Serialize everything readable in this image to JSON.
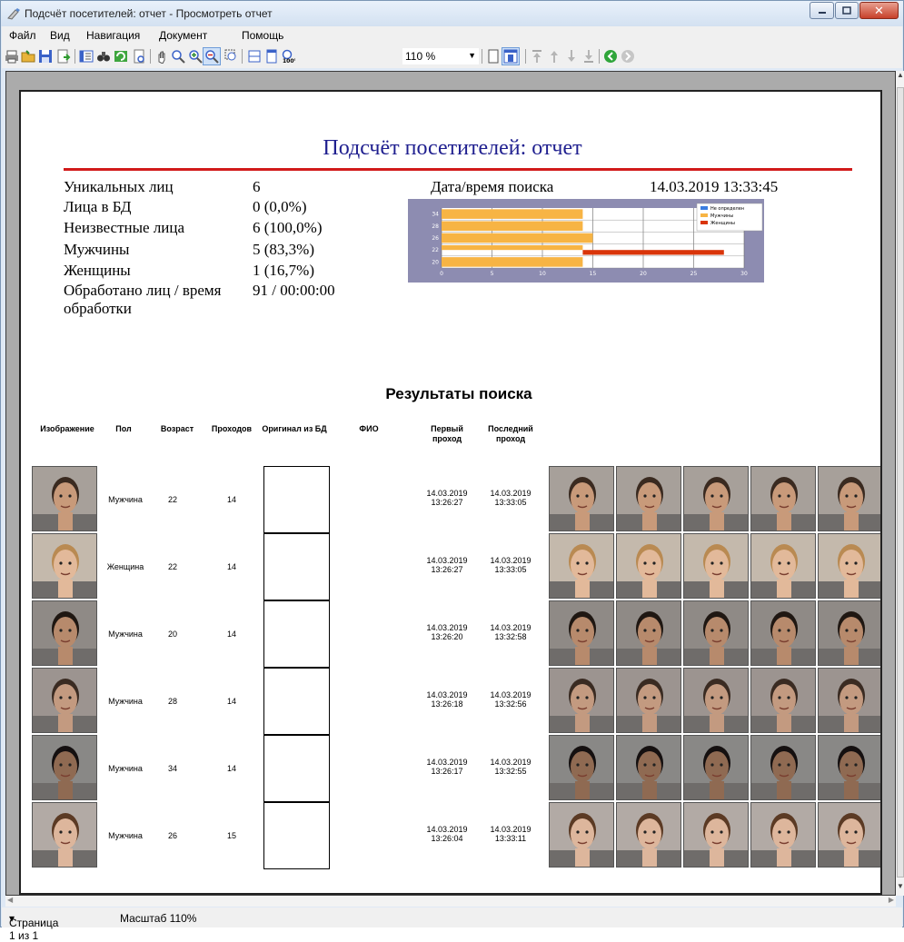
{
  "window": {
    "title": "Подсчёт посетителей: отчет - Просмотреть отчет"
  },
  "menu": [
    "Файл",
    "Вид",
    "Навигация",
    "Документ",
    "Помощь"
  ],
  "toolbar": {
    "zoom_value": "110 %"
  },
  "report": {
    "title": "Подсчёт посетителей: отчет",
    "stats": [
      {
        "label": "Уникальных лиц",
        "value": "6"
      },
      {
        "label": "Лица в БД",
        "value": "0 (0,0%)"
      },
      {
        "label": "Неизвестные лица",
        "value": "6 (100,0%)"
      },
      {
        "label": "Мужчины",
        "value": "5 (83,3%)"
      },
      {
        "label": "Женщины",
        "value": "1 (16,7%)"
      },
      {
        "label": "Обработано лиц / время",
        "label2": "обработки",
        "value": "91 / 00:00:00"
      }
    ],
    "search_dt_label": "Дата/время поиска",
    "search_dt_value": "14.03.2019 13:33:45",
    "results_title": "Результаты поиска",
    "columns": [
      "Изображение",
      "Пол",
      "Возраст",
      "Проходов",
      "Оригинал из БД",
      "ФИО",
      "Первый проход",
      "Последний проход"
    ],
    "rows": [
      {
        "gender": "Мужчина",
        "age": "22",
        "passes": "14",
        "first": [
          "14.03.2019",
          "13:26:27"
        ],
        "last": [
          "14.03.2019",
          "13:33:05"
        ]
      },
      {
        "gender": "Женщина",
        "age": "22",
        "passes": "14",
        "first": [
          "14.03.2019",
          "13:26:27"
        ],
        "last": [
          "14.03.2019",
          "13:33:05"
        ]
      },
      {
        "gender": "Мужчина",
        "age": "20",
        "passes": "14",
        "first": [
          "14.03.2019",
          "13:26:20"
        ],
        "last": [
          "14.03.2019",
          "13:32:58"
        ]
      },
      {
        "gender": "Мужчина",
        "age": "28",
        "passes": "14",
        "first": [
          "14.03.2019",
          "13:26:18"
        ],
        "last": [
          "14.03.2019",
          "13:32:56"
        ]
      },
      {
        "gender": "Мужчина",
        "age": "34",
        "passes": "14",
        "first": [
          "14.03.2019",
          "13:26:17"
        ],
        "last": [
          "14.03.2019",
          "13:32:55"
        ]
      },
      {
        "gender": "Мужчина",
        "age": "26",
        "passes": "15",
        "first": [
          "14.03.2019",
          "13:26:04"
        ],
        "last": [
          "14.03.2019",
          "13:33:11"
        ]
      }
    ]
  },
  "chart_data": {
    "type": "bar",
    "orientation": "horizontal",
    "y_ticks": [
      "34",
      "28",
      "26",
      "22",
      "20"
    ],
    "x_ticks": [
      "0",
      "5",
      "10",
      "15",
      "20",
      "25",
      "30"
    ],
    "xlim": [
      0,
      30
    ],
    "legend": [
      "Не определен",
      "Мужчины",
      "Женщины"
    ],
    "legend_placement": "top-right",
    "colors": {
      "Не определен": "#3a7de0",
      "Мужчины": "#f7b444",
      "Женщины": "#d9350a"
    },
    "bars": [
      {
        "age": "34",
        "series": "Мужчины",
        "value": 14
      },
      {
        "age": "28",
        "series": "Мужчины",
        "value": 14
      },
      {
        "age": "26",
        "series": "Мужчины",
        "value": 15
      },
      {
        "age": "22",
        "series": "Мужчины",
        "value": 14
      },
      {
        "age": "22",
        "series": "Женщины",
        "value": 14
      },
      {
        "age": "20",
        "series": "Мужчины",
        "value": 14
      }
    ]
  },
  "status": {
    "page": "Страница 1 из 1",
    "scale": "Масштаб 110%"
  }
}
